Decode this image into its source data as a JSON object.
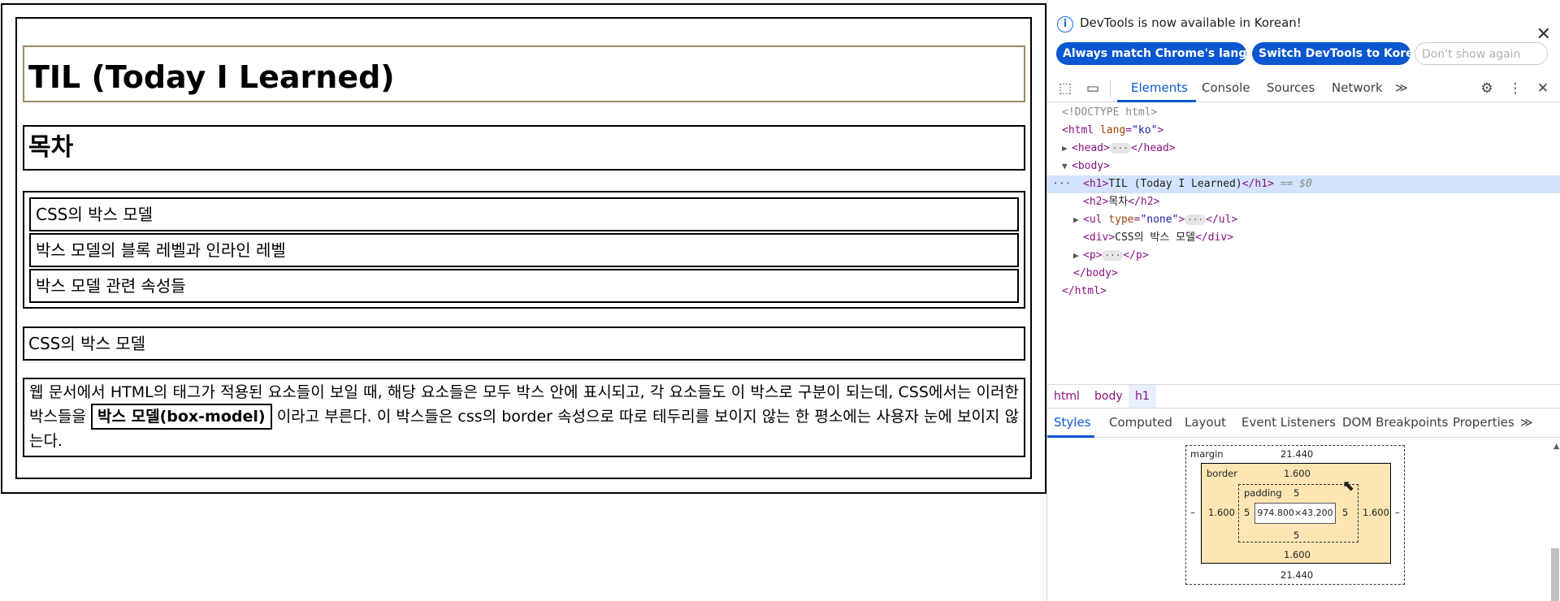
{
  "page": {
    "h1": "TIL (Today I Learned)",
    "h2": "목차",
    "list": [
      "CSS의 박스 모델",
      "박스 모델의 블록 레벨과 인라인 레벨",
      "박스 모델 관련 속성들"
    ],
    "div": "CSS의 박스 모델",
    "paragraph": {
      "before": "웹 문서에서 HTML의 태그가 적용된 요소들이 보일 때, 해당 요소들은 모두 박스 안에 표시되고, 각 요소들도 이 박스로 구분이 되는데, CSS에서는 이러한 박스들을 ",
      "strong": "박스 모델(box-model)",
      "after": " 이라고 부른다. 이 박스들은 css의 border 속성으로 따로 테두리를 보이지 않는 한 평소에는 사용자 눈에 보이지 않는다."
    }
  },
  "devtools": {
    "infobar": {
      "icon": "info-icon",
      "message": "DevTools is now available in Korean!",
      "always_match": "Always match Chrome's language",
      "switch": "Switch DevTools to Korean",
      "dont_show": "Don't show again",
      "close": "✕"
    },
    "toolbar": {
      "inspect_icon": "⬚",
      "device_icon": "▭",
      "tabs": [
        "Elements",
        "Console",
        "Sources",
        "Network"
      ],
      "more": "≫",
      "settings_icon": "⚙",
      "menu_icon": "⋮",
      "close": "✕"
    },
    "dom": {
      "doctype": "<!DOCTYPE html>",
      "html_open": "<html",
      "html_attr": "lang",
      "html_val": "\"ko\"",
      "head": "<head>",
      "head_close": "</head>",
      "body_open": "<body>",
      "h1_open": "<h1>",
      "h1_text": "TIL (Today I Learned)",
      "h1_close": "</h1>",
      "selected_marker": "== $0",
      "h2_open": "<h2>",
      "h2_text": "목차",
      "h2_close": "</h2>",
      "ul_open": "<ul",
      "ul_attr": "type",
      "ul_val": "\"none\"",
      "ul_close": "</ul>",
      "div_open": "<div>",
      "div_text": "CSS의 박스 모델",
      "div_close": "</div>",
      "p_open": "<p>",
      "p_close": "</p>",
      "body_close": "</body>",
      "html_close": "</html>",
      "ellipsis": "···",
      "dots": "···"
    },
    "breadcrumbs": [
      "html",
      "body",
      "h1"
    ],
    "subtabs": [
      "Styles",
      "Computed",
      "Layout",
      "Event Listeners",
      "DOM Breakpoints",
      "Properties"
    ],
    "subtabs_more": "≫",
    "box_model": {
      "margin_label": "margin",
      "margin": "21.440",
      "margin_side": "–",
      "border_label": "border",
      "border": "1.600",
      "padding_label": "padding",
      "padding": "5",
      "content": "974.800×43.200"
    }
  }
}
